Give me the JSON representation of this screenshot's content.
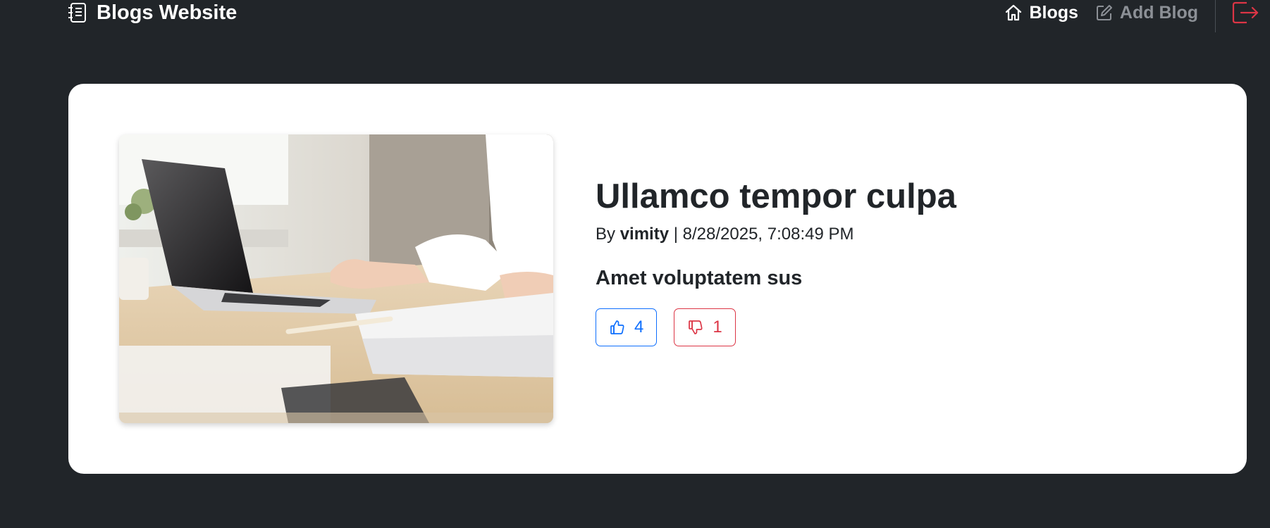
{
  "navbar": {
    "brand": "Blogs Website",
    "links": [
      {
        "label": "Blogs",
        "icon": "home-icon"
      },
      {
        "label": "Add Blog",
        "icon": "pencil-square-icon"
      }
    ],
    "logout_icon": "logout-icon"
  },
  "post": {
    "title": "Ullamco tempor culpa",
    "by_label": "By",
    "author": "vimity",
    "separator": "|",
    "date": "8/28/2025, 7:08:49 PM",
    "excerpt": "Amet voluptatem sus",
    "likes": "4",
    "dislikes": "1",
    "image_alt": "Person typing on a laptop at a wooden desk"
  },
  "colors": {
    "background": "#212529",
    "card": "#ffffff",
    "like": "#0d6efd",
    "dislike": "#dc3545",
    "logout": "#dc3545"
  }
}
